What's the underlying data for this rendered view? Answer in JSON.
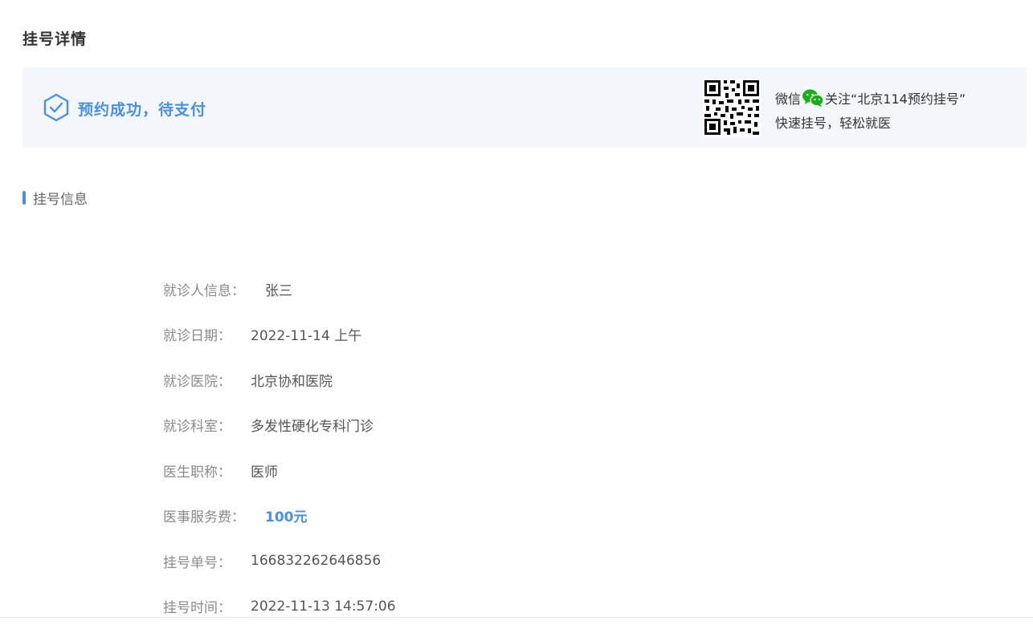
{
  "page": {
    "title": "挂号详情"
  },
  "status": {
    "text": "预约成功，待支付",
    "icon": "shield-check-icon",
    "accent_color": "#4a90e2",
    "banner_bg": "#f3f7fc"
  },
  "wechat": {
    "prefix": "微信",
    "icon": "wechat-icon",
    "follow_text": "关注“北京114预约挂号”",
    "slogan": "快速挂号，轻松就医",
    "qr_icon": "qr-code-icon",
    "icon_color": "#1aad19"
  },
  "section": {
    "title": "挂号信息"
  },
  "info": {
    "patient": {
      "label": "就诊人信息：",
      "value": "张三"
    },
    "date": {
      "label": "就诊日期：",
      "value": "2022-11-14 上午"
    },
    "hospital": {
      "label": "就诊医院：",
      "value": "北京协和医院"
    },
    "department": {
      "label": "就诊科室：",
      "value": "多发性硬化专科门诊"
    },
    "doctor_title": {
      "label": "医生职称：",
      "value": "医师"
    },
    "fee": {
      "label": "医事服务费：",
      "value": "100元"
    },
    "order_no": {
      "label": "挂号单号：",
      "value": "166832262646856"
    },
    "time": {
      "label": "挂号时间：",
      "value": "2022-11-13 14:57:06"
    }
  }
}
